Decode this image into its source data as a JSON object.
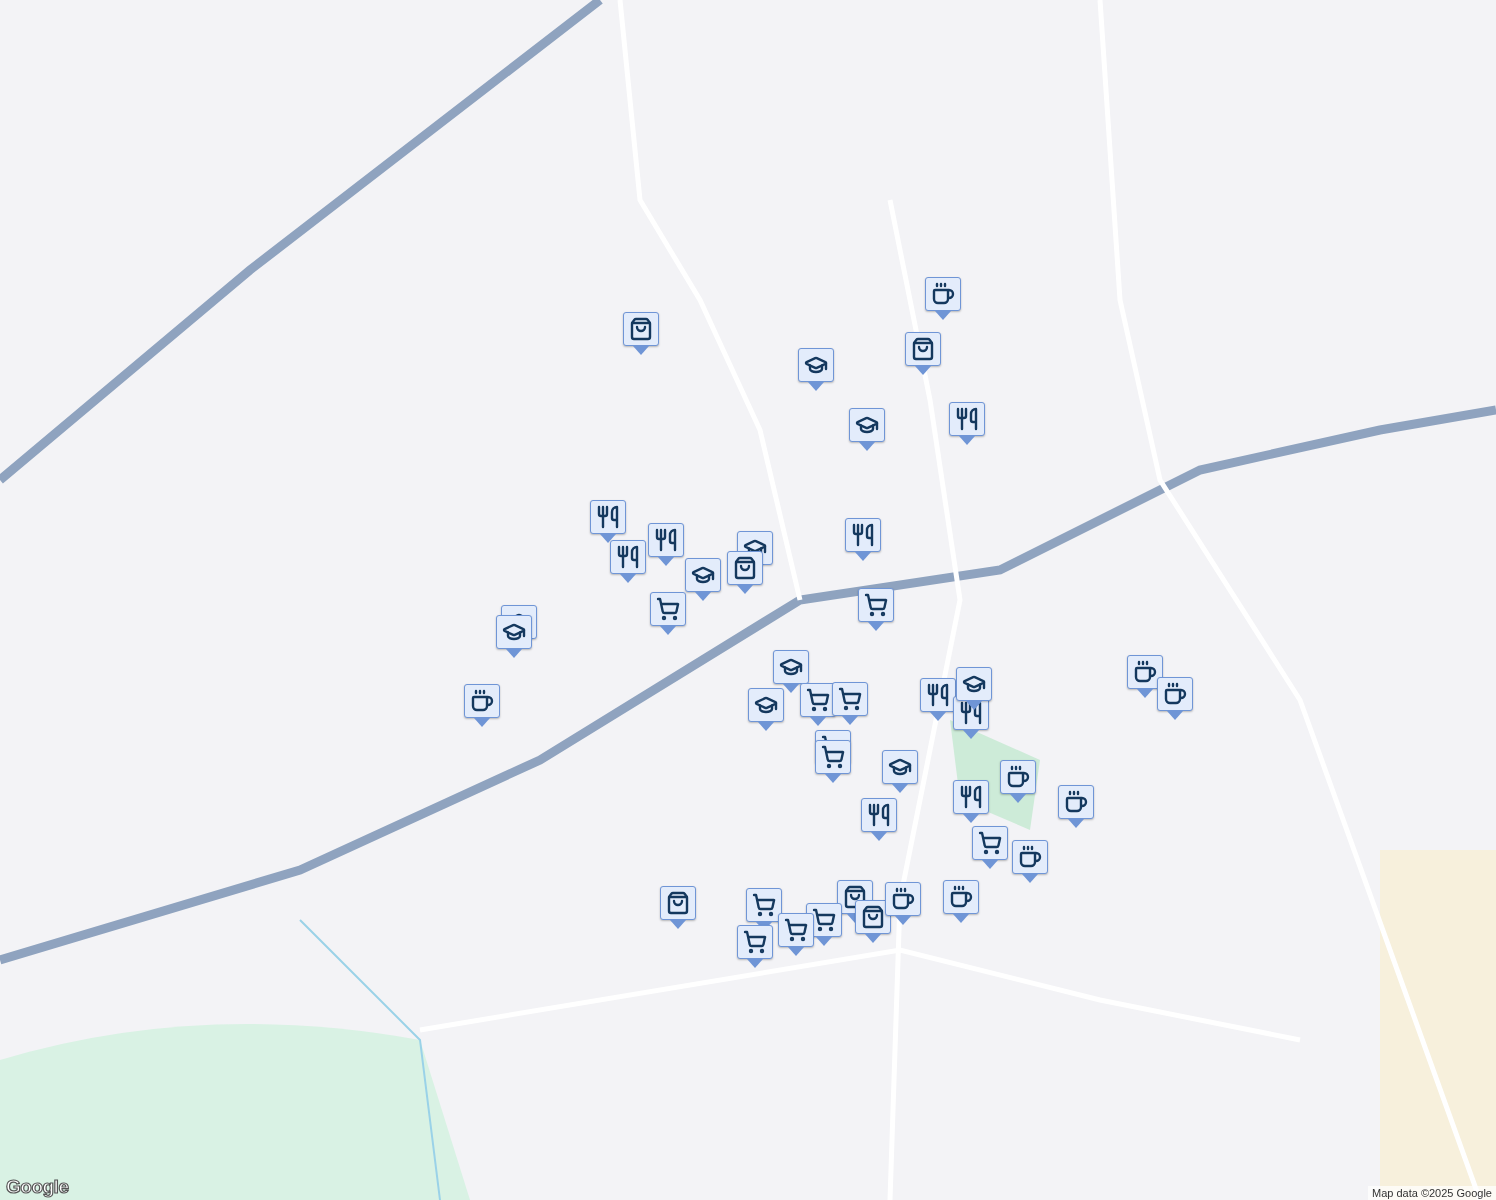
{
  "map": {
    "markers": [
      {
        "kind": "cafe"
      },
      {
        "kind": "shop"
      },
      {
        "kind": "school"
      },
      {
        "kind": "shop"
      },
      {
        "kind": "school"
      },
      {
        "kind": "restaurant"
      },
      {
        "kind": "restaurant"
      },
      {
        "kind": "restaurant"
      },
      {
        "kind": "restaurant"
      },
      {
        "kind": "restaurant"
      },
      {
        "kind": "school"
      },
      {
        "kind": "school"
      },
      {
        "kind": "shop"
      },
      {
        "kind": "cart"
      },
      {
        "kind": "cart"
      },
      {
        "kind": "school"
      },
      {
        "kind": "school"
      },
      {
        "kind": "school"
      },
      {
        "kind": "school"
      },
      {
        "kind": "cafe"
      },
      {
        "kind": "cafe"
      },
      {
        "kind": "cafe"
      },
      {
        "kind": "restaurant"
      },
      {
        "kind": "restaurant"
      },
      {
        "kind": "school"
      },
      {
        "kind": "cart"
      },
      {
        "kind": "cart"
      },
      {
        "kind": "cart"
      },
      {
        "kind": "school"
      },
      {
        "kind": "restaurant"
      },
      {
        "kind": "cafe"
      },
      {
        "kind": "restaurant"
      },
      {
        "kind": "cart"
      },
      {
        "kind": "cafe"
      },
      {
        "kind": "shop"
      },
      {
        "kind": "cart"
      },
      {
        "kind": "shop"
      },
      {
        "kind": "shop"
      },
      {
        "kind": "cafe"
      },
      {
        "kind": "cafe"
      },
      {
        "kind": "cart"
      },
      {
        "kind": "cart"
      },
      {
        "kind": "cart"
      },
      {
        "kind": "cart"
      },
      {
        "kind": "cafe"
      }
    ]
  },
  "logo": "Google",
  "attribution": "Map data ©2025 Google"
}
